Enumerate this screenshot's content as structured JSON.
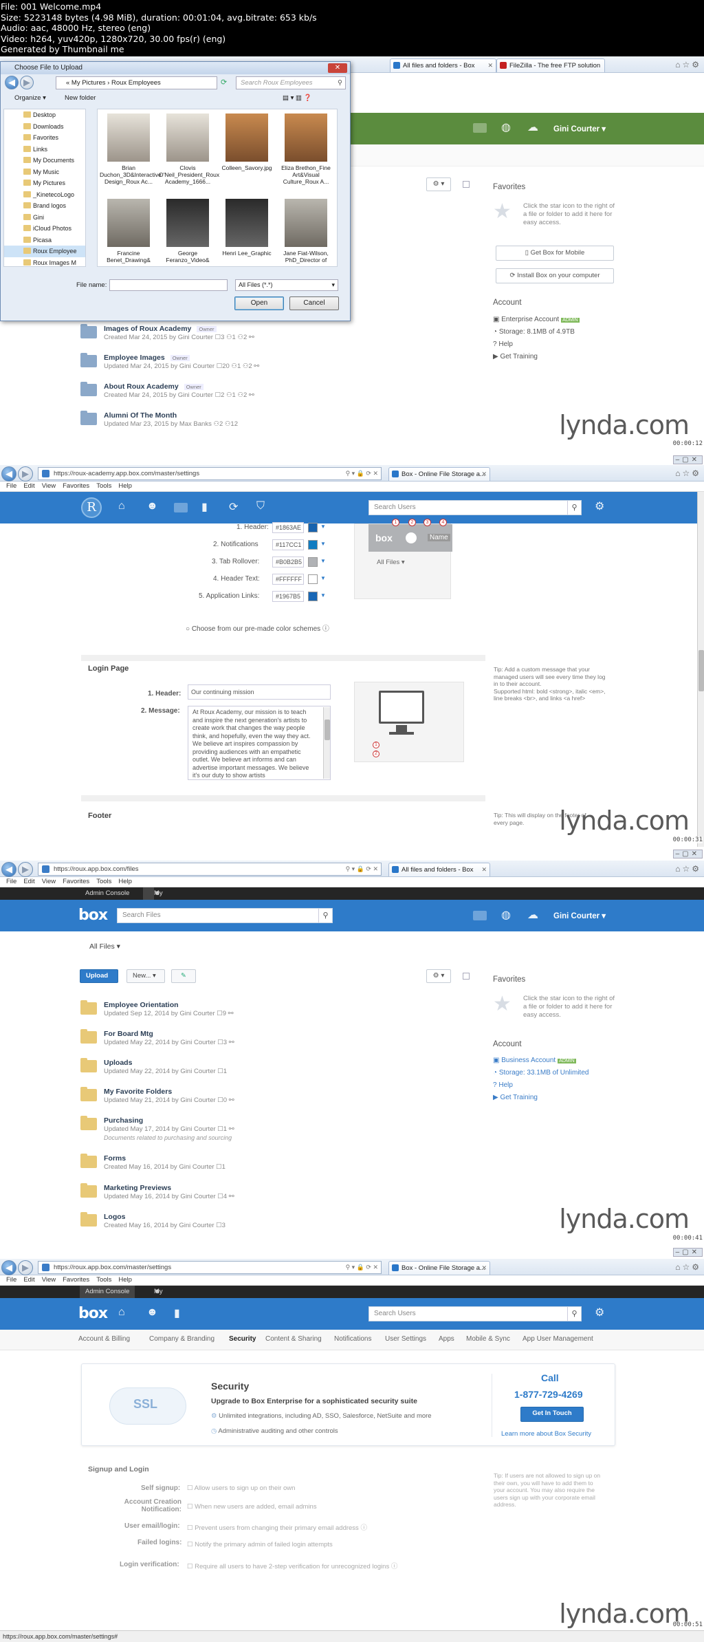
{
  "meta": {
    "lines": [
      "File: 001 Welcome.mp4",
      "Size: 5223148 bytes (4.98 MiB), duration: 00:01:04, avg.bitrate: 653 kb/s",
      "Audio: aac, 48000 Hz, stereo (eng)",
      "Video: h264, yuv420p, 1280x720, 30.00 fps(r) (eng)",
      "Generated by Thumbnail me"
    ]
  },
  "watermark": "lynda.com",
  "frame1": {
    "tabs": [
      "All files and folders - Box",
      "FileZilla - The free FTP solution"
    ],
    "user": "Gini Courter",
    "stamp": "00:00:12",
    "dialog": {
      "title": "Choose File to Upload",
      "path": "« My Pictures › Roux Employees",
      "search_placeholder": "Search Roux Employees",
      "organize": "Organize ▾",
      "new_folder": "New folder",
      "tree": [
        "Desktop",
        "Downloads",
        "Favorites",
        "Links",
        "My Documents",
        "My Music",
        "My Pictures",
        "_KinetecoLogo",
        "Brand logos",
        "Gini",
        "iCloud Photos",
        "Picasa",
        "Roux Employee",
        "Roux Images M"
      ],
      "files": [
        "Brian Duchon_3D&Interactive Design_Roux Ac...",
        "Clovis O'Neil_President_Roux Academy_1666...",
        "Colleen_Savory.jpg",
        "Eliza Brethon_Fine Art&Visual Culture_Roux A...",
        "Francine Benet_Drawing&",
        "George Feranzo_Video&",
        "Henri Lee_Graphic",
        "Jane Fiat-Wilson, PhD_Director of"
      ],
      "file_name_label": "File name:",
      "file_type": "All Files (*.*)",
      "open": "Open",
      "cancel": "Cancel"
    },
    "favorites_title": "Favorites",
    "favorites_hint": "Click the star icon to the right of a file or folder to add it here for easy access.",
    "box_mobile": "Get Box for Mobile",
    "box_sync": "Install Box on your computer",
    "account_title": "Account",
    "account": [
      "Enterprise Account",
      "Storage: 8.1MB of 4.9TB",
      "Help",
      "Get Training"
    ],
    "admin_badge": "ADMIN",
    "owner_badge": "Owner",
    "folders": [
      {
        "name": "Images of Roux Academy",
        "sub": "Created Mar 24, 2015 by Gini Courter   ☐3  ⚇1  ⚇2  ⚯"
      },
      {
        "name": "Employee Images",
        "sub": "Updated Mar 24, 2015 by Gini Courter   ☐20  ⚇1  ⚇2  ⚯"
      },
      {
        "name": "About Roux Academy",
        "sub": "Created Mar 24, 2015 by Gini Courter   ☐2  ⚇1  ⚇2  ⚯"
      },
      {
        "name": "Alumni Of The Month",
        "sub": "Updated Mar 23, 2015 by Max Banks   ⚇2  ⚇12"
      }
    ]
  },
  "frame2": {
    "url": "https://roux-academy.app.box.com/master/settings",
    "tab": "Box - Online File Storage a...",
    "menu": [
      "File",
      "Edit",
      "View",
      "Favorites",
      "Tools",
      "Help"
    ],
    "search_placeholder": "Search Users",
    "stamp": "00:00:31",
    "colors": [
      {
        "label": "1. Header:",
        "hex": "1863AE",
        "color": "#1863AE"
      },
      {
        "label": "2. Notifications",
        "hex": "117CC1",
        "color": "#117CC1"
      },
      {
        "label": "3. Tab Rollover:",
        "hex": "B0B2B5",
        "color": "#B0B2B5"
      },
      {
        "label": "4. Header Text:",
        "hex": "FFFFFF",
        "color": "#FFFFFF"
      },
      {
        "label": "5. Application Links:",
        "hex": "1967B5",
        "color": "#1967B5"
      }
    ],
    "preview_all_files": "All Files ▾",
    "preview_name": "Name",
    "premade": "Choose from our pre-made color schemes",
    "login_title": "Login Page",
    "header_label": "1. Header:",
    "header_value": "Our continuing mission",
    "message_label": "2. Message:",
    "message_value": "At Roux Academy, our mission is to teach and inspire the next generation's artists to create work that changes the way people think, and hopefully, even the way they act. We believe art inspires compassion by providing audiences with an empathetic outlet. We believe art informs and can advertise important messages. We believe it's our duty to show artists",
    "tip_login": "Tip: Add a custom message that your managed users will see every time they log in to their account.",
    "tip_html": "Supported html: bold <strong>, italic <em>, line breaks <br>, and links <a href>",
    "footer_title": "Footer",
    "tip_footer": "Tip: This will display on the footer of every page."
  },
  "frame3": {
    "url": "https://roux.app.box.com/files",
    "tab": "All files and folders - Box",
    "admin_console": "Admin Console",
    "my_account": "My Account",
    "search_placeholder": "Search Files",
    "user": "Gini Courter",
    "crumb": "All Files ▾",
    "upload": "Upload ▾",
    "new": "New... ▾",
    "stamp": "00:00:41",
    "favorites_title": "Favorites",
    "favorites_hint": "Click the star icon to the right of a file or folder to add it here for easy access.",
    "account_title": "Account",
    "account": [
      "Business Account",
      "Storage: 33.1MB of Unlimited",
      "Help",
      "Get Training"
    ],
    "folders": [
      {
        "name": "Employee Orientation",
        "sub": "Updated Sep 12, 2014 by Gini Courter   ☐9  ⚯",
        "desc": ""
      },
      {
        "name": "For Board Mtg",
        "sub": "Updated May 22, 2014 by Gini Courter   ☐3  ⚯",
        "desc": ""
      },
      {
        "name": "Uploads",
        "sub": "Updated May 22, 2014 by Gini Courter   ☐1",
        "desc": ""
      },
      {
        "name": "My Favorite Folders",
        "sub": "Updated May 21, 2014 by Gini Courter   ☐0  ⚯",
        "desc": ""
      },
      {
        "name": "Purchasing",
        "sub": "Updated May 17, 2014 by Gini Courter   ☐1  ⚯",
        "desc": "Documents related to purchasing and sourcing"
      },
      {
        "name": "Forms",
        "sub": "Created May 16, 2014 by Gini Courter   ☐1",
        "desc": ""
      },
      {
        "name": "Marketing Previews",
        "sub": "Updated May 16, 2014 by Gini Courter   ☐4  ⚯",
        "desc": ""
      },
      {
        "name": "Logos",
        "sub": "Created May 16, 2014 by Gini Courter   ☐3",
        "desc": ""
      }
    ]
  },
  "frame4": {
    "url": "https://roux.app.box.com/master/settings",
    "tab": "Box - Online File Storage a...",
    "search_placeholder": "Search Users",
    "stamp": "00:00:51",
    "nav": [
      "Account & Billing",
      "Company & Branding",
      "Security",
      "Content & Sharing",
      "Notifications",
      "User Settings",
      "Apps",
      "Mobile & Sync",
      "App User Management"
    ],
    "ssl": "SSL",
    "security_title": "Security",
    "security_sub": "Upgrade to Box Enterprise for a sophisticated security suite",
    "bullet1": "Unlimited integrations, including AD, SSO, Salesforce, NetSuite and more",
    "bullet2": "Administrative auditing and other controls",
    "call": "Call",
    "phone": "1-877-729-4269",
    "get_in_touch": "Get In Touch",
    "learn_more": "Learn more about Box Security",
    "signup_title": "Signup and Login",
    "rows": [
      {
        "label": "Self signup:",
        "text": "Allow users to sign up on their own"
      },
      {
        "label": "Account Creation Notification:",
        "text": "When new users are added, email admins"
      },
      {
        "label": "User email/login:",
        "text": "Prevent users from changing their primary email address"
      },
      {
        "label": "Failed logins:",
        "text": "Notify the primary admin of failed login attempts"
      },
      {
        "label": "Login verification:",
        "text": "Require all users to have 2-step verification for unrecognized logins"
      }
    ],
    "tip": "Tip: If users are not allowed to sign up on their own, you will have to add them to your account. You may also require the users sign up with your corporate email address.",
    "status": "https://roux.app.box.com/master/settings#"
  }
}
